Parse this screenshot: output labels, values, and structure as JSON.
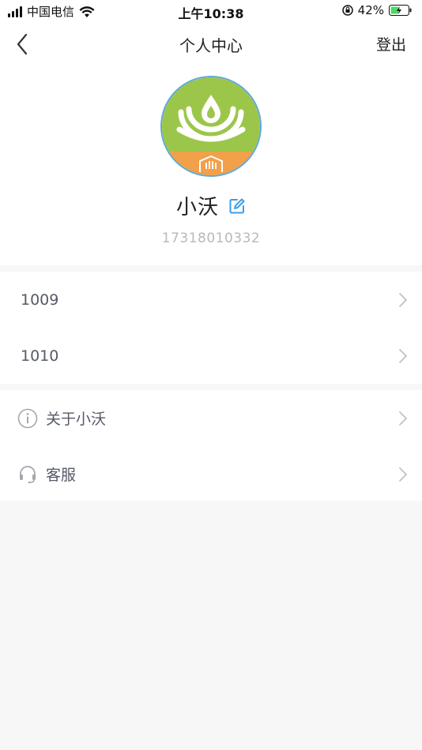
{
  "status_bar": {
    "carrier": "中国电信",
    "time": "上午10:38",
    "battery_percent": "42%"
  },
  "header": {
    "title": "个人中心",
    "logout_label": "登出"
  },
  "profile": {
    "name": "小沃",
    "phone": "17318010332",
    "avatar_colors": {
      "top": "#9cc64a",
      "bottom": "#f2a04a",
      "border": "#5fa8d8"
    }
  },
  "list_group_1": [
    {
      "label": "1009"
    },
    {
      "label": "1010"
    }
  ],
  "list_group_2": [
    {
      "label": "关于小沃",
      "icon": "info-icon"
    },
    {
      "label": "客服",
      "icon": "headset-icon"
    }
  ],
  "colors": {
    "accent": "#3a9ee6",
    "muted_text": "#b7b9bf",
    "row_text": "#555a66"
  }
}
